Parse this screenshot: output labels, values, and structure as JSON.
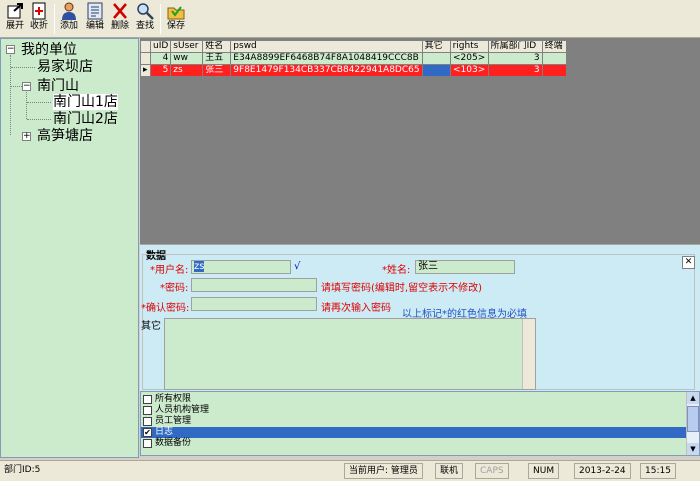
{
  "toolbar": {
    "expand": "展开",
    "collapse": "收折",
    "add": "添加",
    "edit": "编辑",
    "delete": "删除",
    "find": "查找",
    "save": "保存"
  },
  "tree": {
    "root": "我的单位",
    "n1": "易家坝店",
    "n2": "南门山",
    "n3": "南门山1店",
    "n4": "南门山2店",
    "n5": "高笋塘店"
  },
  "grid": {
    "columns": [
      "uID",
      "sUser",
      "姓名",
      "pswd",
      "其它",
      "rights",
      "所属部门ID",
      "终端"
    ],
    "rows": [
      {
        "indicator": "",
        "uid": "4",
        "suser": "ww",
        "name": "王五",
        "pswd": "E34A8899EF6468B74F8A1048419CCC8B",
        "other": "",
        "rights": "<205>",
        "dept": "3",
        "term": ""
      },
      {
        "indicator": "▸",
        "uid": "5",
        "suser": "zs",
        "name": "张三",
        "pswd": "9F8E1479F134CB337CB8422941A8DC65",
        "other": "",
        "rights": "<103>",
        "dept": "3",
        "term": ""
      }
    ]
  },
  "form": {
    "group": "数据",
    "user_label": "*用户名:",
    "user_value": "zs",
    "check": "√",
    "name_label": "*姓名:",
    "name_value": "张三",
    "pwd_label": "*密码:",
    "pwd_hint": "请填写密码(编辑时,留空表示不修改)",
    "pwd2_label": "*确认密码:",
    "pwd2_hint": "请再次输入密码",
    "required_note": "以上标记*的红色信息为必填",
    "other_label": "其它",
    "close": "✕"
  },
  "perms": [
    {
      "label": "所有权限",
      "checked": false,
      "selected": false
    },
    {
      "label": "人员机构管理",
      "checked": false,
      "selected": false
    },
    {
      "label": "员工管理",
      "checked": false,
      "selected": false
    },
    {
      "label": "日志",
      "checked": true,
      "selected": true
    },
    {
      "label": "数据备份",
      "checked": false,
      "selected": false
    }
  ],
  "status": {
    "dept": "部门ID:5",
    "user": "当前用户: 管理员",
    "online": "联机",
    "caps": "CAPS",
    "num": "NUM",
    "date": "2013-2-24",
    "time": "15:15"
  }
}
